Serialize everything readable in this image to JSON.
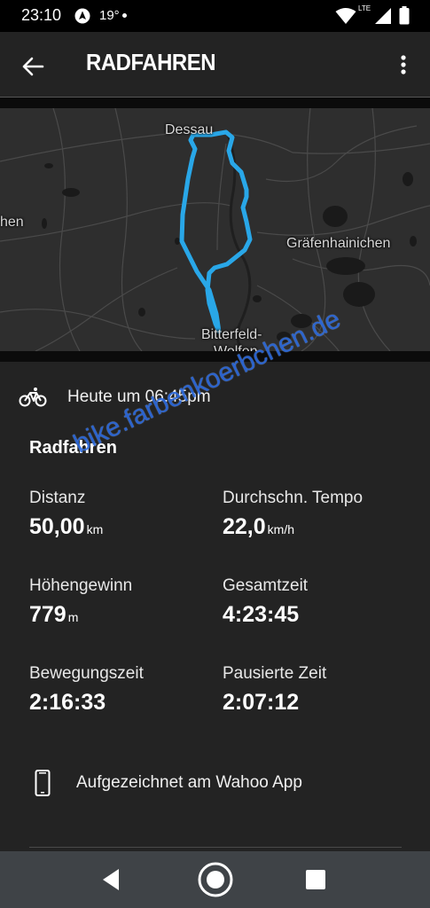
{
  "status_bar": {
    "time": "23:10",
    "temperature": "19°",
    "network_label": "LTE"
  },
  "app_bar": {
    "title": "RADFAHREN"
  },
  "map": {
    "labels": {
      "dessau": "Dessau",
      "left_town": "hen",
      "graefenhainichen": "Gräfenhainichen",
      "bitterfeld": "Bitterfeld-",
      "wolfen": "Wolfen"
    },
    "route_color": "#29a7e8"
  },
  "activity": {
    "date_text": "Heute um 06:45pm",
    "section_title": "Radfahren",
    "stats": {
      "distance": {
        "label": "Distanz",
        "value": "50,00",
        "unit": "km"
      },
      "avg_speed": {
        "label": "Durchschn. Tempo",
        "value": "22,0",
        "unit": "km/h"
      },
      "elevation": {
        "label": "Höhengewinn",
        "value": "779",
        "unit": "m"
      },
      "total_time": {
        "label": "Gesamtzeit",
        "value": "4:23:45"
      },
      "moving_time": {
        "label": "Bewegungszeit",
        "value": "2:16:33"
      },
      "paused_time": {
        "label": "Pausierte Zeit",
        "value": "2:07:12"
      }
    },
    "recorded_text": "Aufgezeichnet am Wahoo App"
  },
  "watermark": "bike.farbenkoerbchen.de",
  "icons": {
    "back": "arrow-left-icon",
    "more": "more-vert-icon",
    "bike": "bicycle-icon",
    "phone": "smartphone-icon"
  }
}
